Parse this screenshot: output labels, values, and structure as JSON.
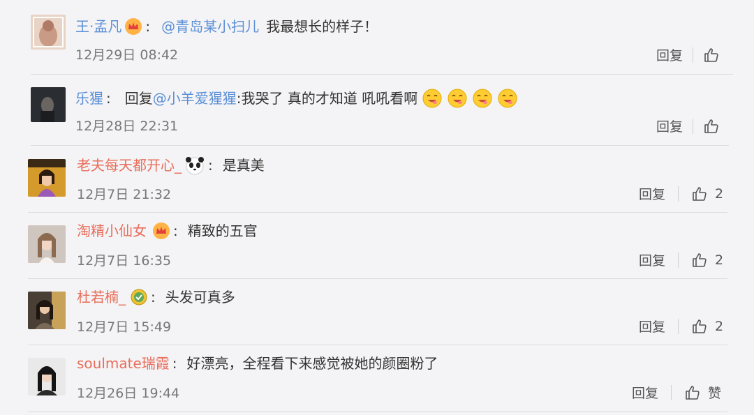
{
  "comments": [
    {
      "user": "王·孟凡",
      "mention": "@青岛某小扫儿",
      "text": "我最想长的样子！",
      "time": "12月29日 08:42",
      "reply_label": "回复",
      "like_count": "",
      "badge": "crown-icon",
      "name_color": "#5b8fd6"
    },
    {
      "user": "乐猩",
      "reply_prefix": "回复",
      "mention": "@小羊爱猩猩",
      "text": ":我哭了 真的才知道 吼吼看啊",
      "time": "12月28日 22:31",
      "reply_label": "回复",
      "like_count": "",
      "emojis": [
        "yummy-emoji",
        "yummy-emoji",
        "yummy-emoji",
        "yummy-emoji"
      ],
      "name_color": "#5b8fd6"
    },
    {
      "user": "老夫每天都开心_",
      "text": "是真美",
      "time": "12月7日 21:32",
      "reply_label": "回复",
      "like_count": "2",
      "badge": "panda-icon",
      "name_color": "#e96d5a"
    },
    {
      "user": "淘精小仙女",
      "text": "精致的五官",
      "time": "12月7日 16:35",
      "reply_label": "回复",
      "like_count": "2",
      "badge": "crown-icon",
      "name_color": "#e96d5a"
    },
    {
      "user": "杜若楠_",
      "text": "头发可真多",
      "time": "12月7日 15:49",
      "reply_label": "回复",
      "like_count": "2",
      "badge": "medal-icon",
      "name_color": "#e96d5a"
    },
    {
      "user": "soulmate瑞霞",
      "text": "好漂亮，全程看下来感觉被她的颜圈粉了",
      "time": "12月26日 19:44",
      "reply_label": "回复",
      "like_count": "赞",
      "name_color": "#e96d5a"
    }
  ],
  "colors": {
    "link_blue": "#5b8fd6",
    "name_orange": "#e96d5a",
    "background": "#f4f4f6"
  }
}
